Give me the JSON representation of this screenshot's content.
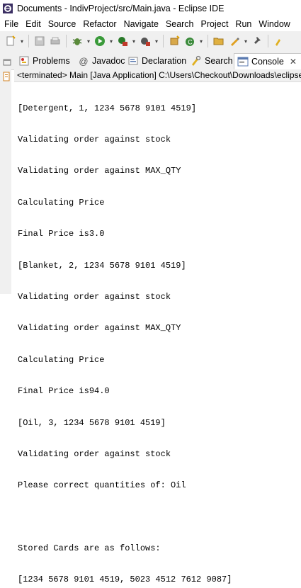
{
  "window": {
    "title": "Documents - IndivProject/src/Main.java - Eclipse IDE"
  },
  "menu": {
    "items": [
      "File",
      "Edit",
      "Source",
      "Refactor",
      "Navigate",
      "Search",
      "Project",
      "Run",
      "Window"
    ]
  },
  "toolbar": {
    "icons": [
      "new-icon",
      "save-icon",
      "print-icon",
      "debug-icon",
      "run-icon",
      "external-tools-icon",
      "run-coverage-icon",
      "new-java-package-icon",
      "new-java-class-icon",
      "open-folder-icon",
      "pen-icon",
      "pin-icon",
      "search-icon"
    ]
  },
  "tabs": [
    {
      "label": "Problems",
      "icon": "problems-icon",
      "active": false
    },
    {
      "label": "Javadoc",
      "icon": "javadoc-icon",
      "active": false
    },
    {
      "label": "Declaration",
      "icon": "declaration-icon",
      "active": false
    },
    {
      "label": "Search",
      "icon": "search-icon",
      "active": false
    },
    {
      "label": "Console",
      "icon": "console-icon",
      "active": true,
      "close": "✕"
    }
  ],
  "console": {
    "status": "<terminated> Main [Java Application] C:\\Users\\Checkout\\Downloads\\eclipse",
    "lines": [
      "[Detergent, 1, 1234 5678 9101 4519]",
      "Validating order against stock",
      "Validating order against MAX_QTY",
      "Calculating Price",
      "Final Price is3.0",
      "[Blanket, 2, 1234 5678 9101 4519]",
      "Validating order against stock",
      "Validating order against MAX_QTY",
      "Calculating Price",
      "Final Price is94.0",
      "[Oil, 3, 1234 5678 9101 4519]",
      "Validating order against stock",
      "Please correct quantities of: Oil",
      "",
      "Stored Cards are as follows:",
      "[1234 5678 9101 4519, 5023 4512 7612 9087]"
    ]
  }
}
